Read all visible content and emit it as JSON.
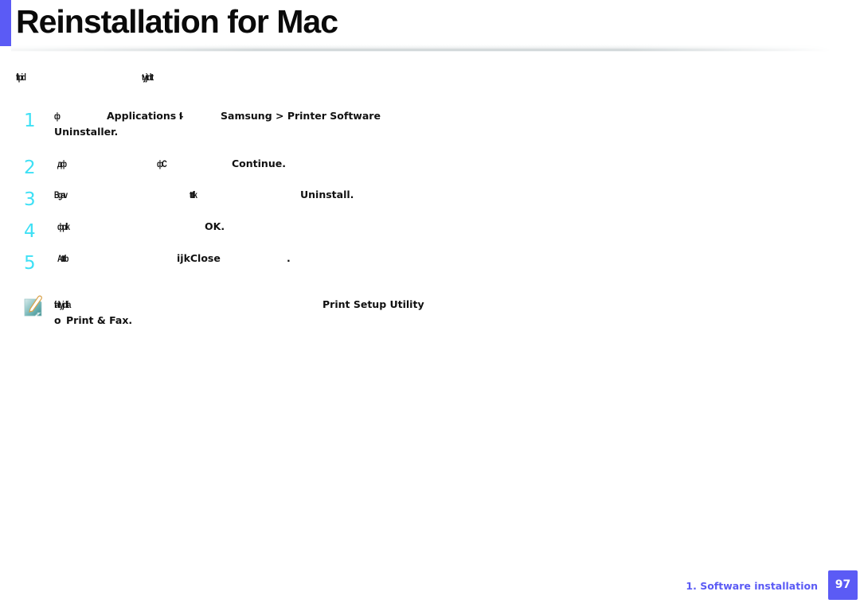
{
  "header": {
    "title": "Reinstallation for Mac",
    "accent_color": "#5b5bf5"
  },
  "intro": {
    "fragment_1": "ftpid",
    "fragment_2": "tyjtdtt"
  },
  "steps": [
    {
      "number": "1",
      "parts": [
        "ф",
        "Applications",
        "fl-",
        "Samsung > Printer Software",
        "Uninstaller."
      ]
    },
    {
      "number": "2",
      "parts": [
        "дф",
        "фC",
        "Continue."
      ]
    },
    {
      "number": "3",
      "parts": [
        "Bgav",
        "tttlk",
        "Uninstall."
      ]
    },
    {
      "number": "4",
      "parts": [
        "фplk",
        "OK."
      ]
    },
    {
      "number": "5",
      "parts": [
        "Atttb",
        "ijkClose",
        "."
      ]
    }
  ],
  "note": {
    "icon": "note-pencil-icon",
    "fragment_1": "faltyjdfa",
    "bold_1": "Print Setup Utility",
    "prefix_2": "o",
    "bold_2": "Print & Fax."
  },
  "footer": {
    "section_label": "1.  Software installation",
    "page_number": "97",
    "accent_color": "#5b5bf5"
  },
  "colors": {
    "step_number": "#3ee0f5",
    "text": "#111111"
  }
}
